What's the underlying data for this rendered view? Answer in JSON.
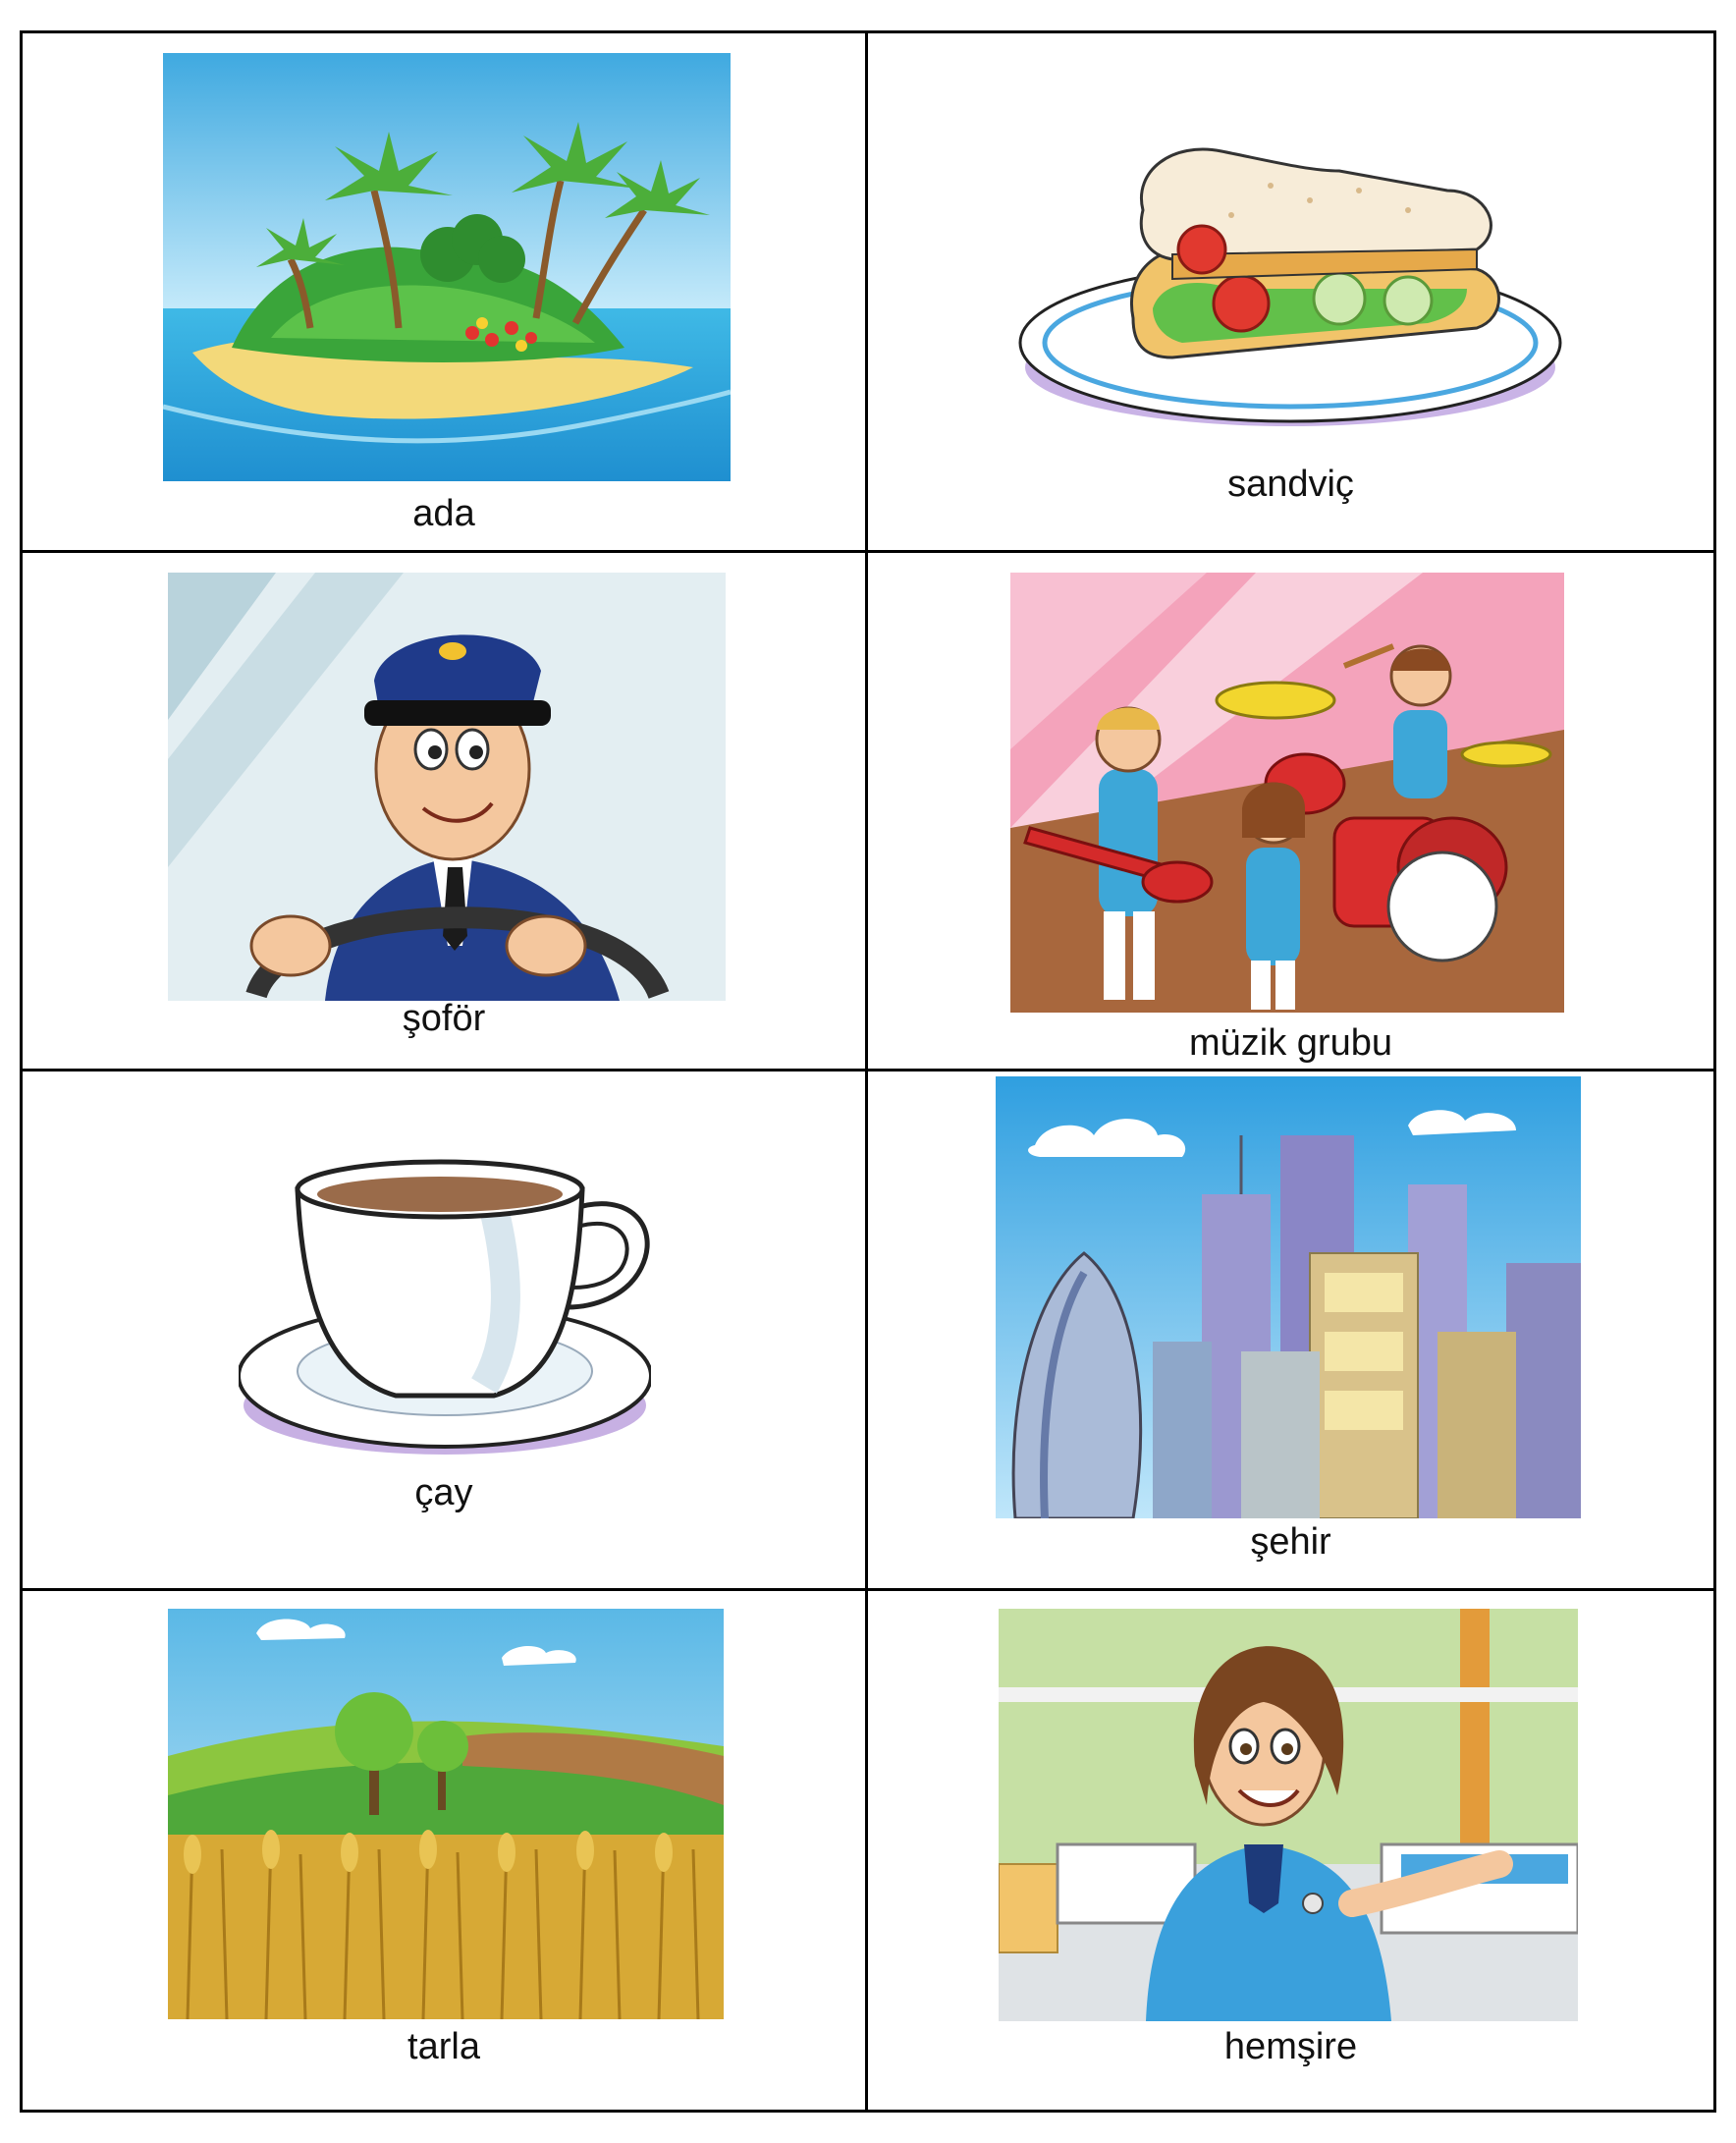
{
  "cards": [
    {
      "label": "ada",
      "icon": "island-icon"
    },
    {
      "label": "sandviç",
      "icon": "sandwich-icon"
    },
    {
      "label": "şoför",
      "icon": "driver-icon"
    },
    {
      "label": "müzik grubu",
      "icon": "music-band-icon"
    },
    {
      "label": "çay",
      "icon": "tea-cup-icon"
    },
    {
      "label": "şehir",
      "icon": "city-icon"
    },
    {
      "label": "tarla",
      "icon": "field-icon"
    },
    {
      "label": "hemşire",
      "icon": "nurse-icon"
    }
  ]
}
